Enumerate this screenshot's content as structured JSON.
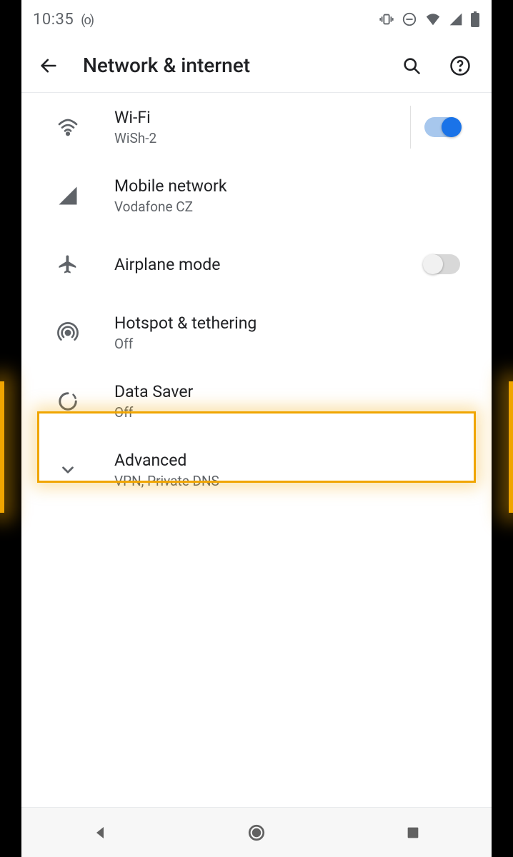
{
  "status": {
    "time": "10:35",
    "hotspot_glyph": "(o)"
  },
  "header": {
    "title": "Network & internet"
  },
  "rows": {
    "wifi": {
      "label": "Wi-Fi",
      "sub": "WiSh-2"
    },
    "mobile": {
      "label": "Mobile network",
      "sub": "Vodafone CZ"
    },
    "airplane": {
      "label": "Airplane mode"
    },
    "hotspot": {
      "label": "Hotspot & tethering",
      "sub": "Off"
    },
    "datasaver": {
      "label": "Data Saver",
      "sub": "Off"
    },
    "advanced": {
      "label": "Advanced",
      "sub": "VPN, Private DNS"
    }
  }
}
